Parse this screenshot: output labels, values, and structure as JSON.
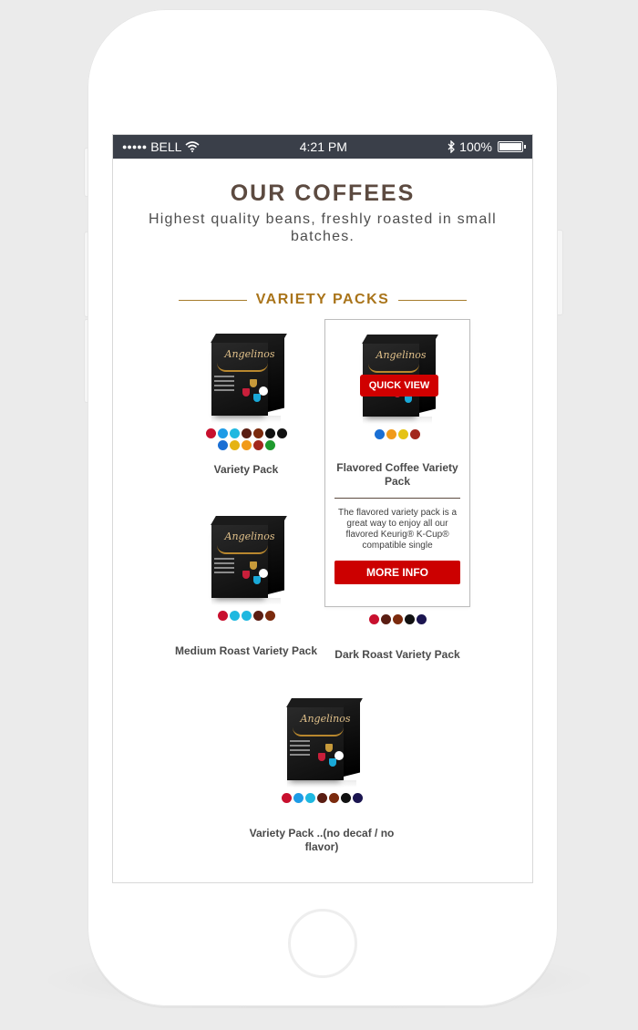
{
  "status_bar": {
    "signal": "●●●●●",
    "carrier": "BELL",
    "wifi_icon": "wifi-icon",
    "time": "4:21 PM",
    "bluetooth_icon": "bluetooth-icon",
    "battery": "100%"
  },
  "hero": {
    "title": "OUR COFFEES",
    "subtitle": "Highest quality beans, freshly roasted in small batches."
  },
  "section": {
    "title": "VARIETY PACKS"
  },
  "brand_script": "Angelinos",
  "colors": {
    "accent": "#a9741a",
    "button_red": "#cc0000",
    "statusbar": "#3a3f49",
    "title_brown": "#5c4a40"
  },
  "products": [
    {
      "name": "Variety Pack",
      "swatches": [
        "#c8102e",
        "#1e9be6",
        "#1fb8e0",
        "#5a1d12",
        "#7b2a0d",
        "#111111",
        "#111111",
        "#1a6fd4",
        "#e5b313",
        "#f19a1a",
        "#a3271d",
        "#1e9a2e"
      ]
    },
    {
      "name": "Flavored Coffee Variety Pack",
      "swatches": [
        "#1a6fd4",
        "#f19a1a",
        "#e5c313",
        "#a3271d"
      ],
      "quick_view": "QUICK VIEW",
      "description": "The flavored variety pack is a great way to enjoy all our flavored Keurig® K-Cup® compatible single",
      "more_info": "MORE INFO"
    },
    {
      "name": "Medium Roast Variety Pack",
      "swatches": [
        "#c8102e",
        "#1fb8e0",
        "#1fb8e0",
        "#5a1d12",
        "#7b2a0d"
      ]
    },
    {
      "name": "Dark Roast Variety Pack",
      "swatches": [
        "#c8102e",
        "#5a1d12",
        "#7b2a0d",
        "#111111",
        "#1b1550"
      ]
    },
    {
      "name": "Variety Pack ..(no decaf / no flavor)",
      "swatches": [
        "#c8102e",
        "#1e9be6",
        "#1fb8e0",
        "#5a1d12",
        "#7b2a0d",
        "#111111",
        "#1b1550"
      ]
    }
  ]
}
